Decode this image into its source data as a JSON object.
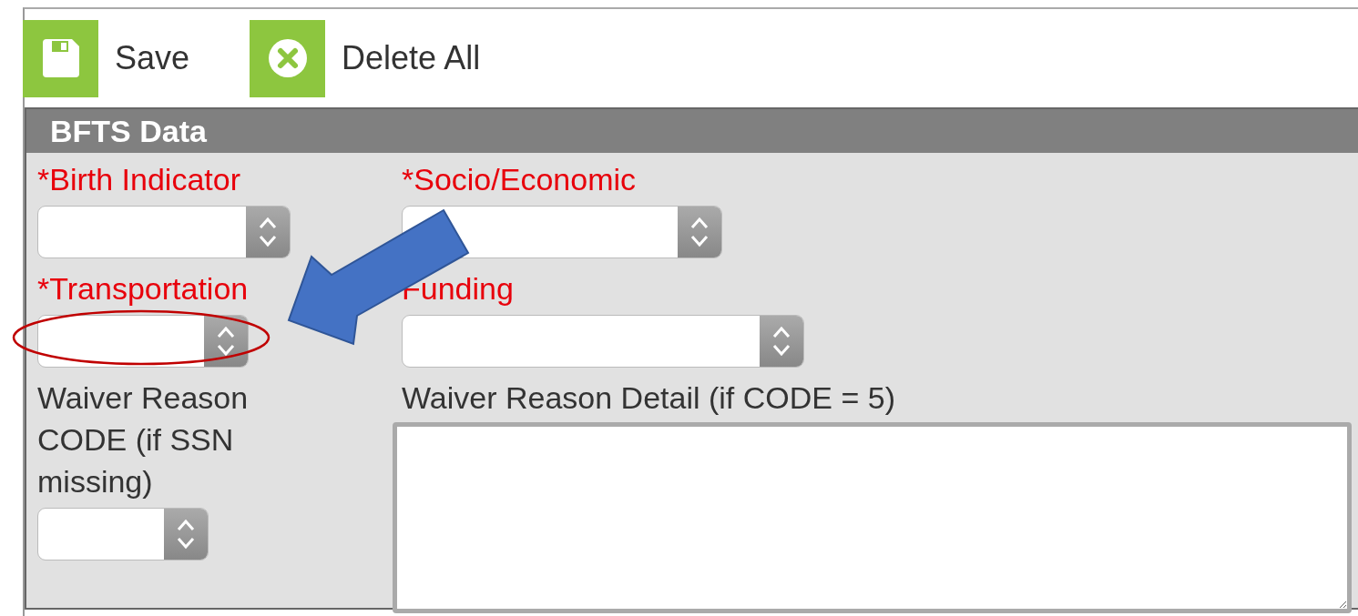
{
  "toolbar": [
    {
      "label": "Save"
    },
    {
      "label": "Delete All"
    }
  ],
  "panel": {
    "title": "BFTS Data",
    "fields": [
      {
        "label": "*Birth Indicator",
        "required": true,
        "kind": "select"
      },
      {
        "label": "*Socio/Economic",
        "required": true,
        "kind": "select"
      },
      {
        "label": "*Transportation",
        "required": true,
        "kind": "select"
      },
      {
        "label": "Funding",
        "required": true,
        "kind": "select"
      },
      {
        "label": "Waiver Reason CODE (if SSN missing)",
        "required": false,
        "kind": "select"
      },
      {
        "label": "Waiver Reason Detail (if CODE = 5)",
        "required": false,
        "kind": "textarea"
      }
    ]
  },
  "annotations": {
    "arrow": true,
    "ellipse": true
  }
}
